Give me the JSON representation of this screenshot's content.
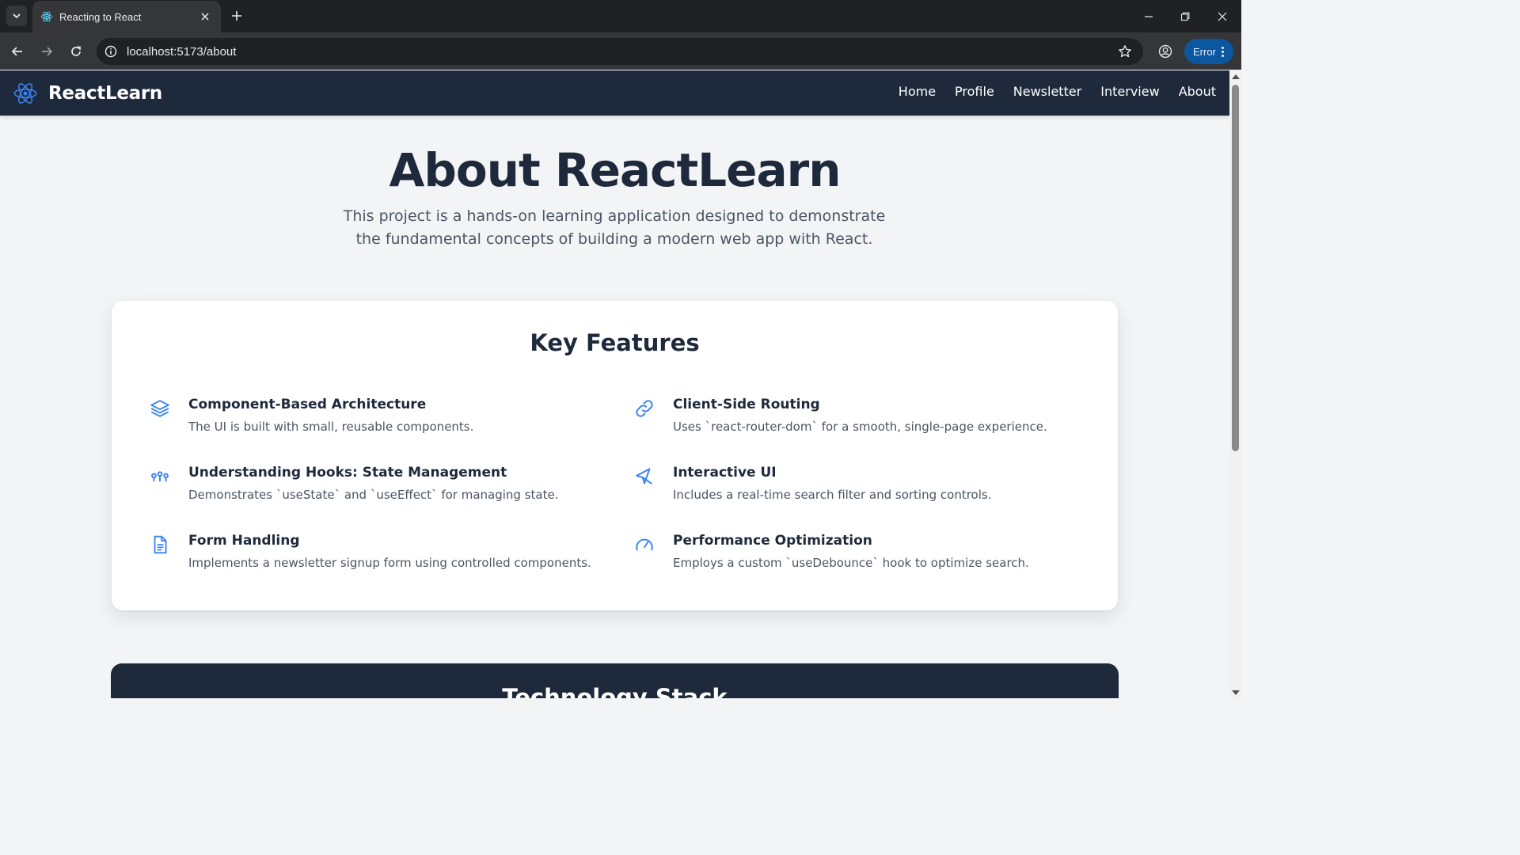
{
  "browser": {
    "tab_title": "Reacting to React",
    "url": "localhost:5173/about",
    "error_label": "Error"
  },
  "site": {
    "brand": "ReactLearn",
    "nav": [
      "Home",
      "Profile",
      "Newsletter",
      "Interview",
      "About"
    ]
  },
  "hero": {
    "title": "About ReactLearn",
    "subtitle": "This project is a hands-on learning application designed to demonstrate the fundamental concepts of building a modern web app with React."
  },
  "features_card": {
    "title": "Key Features",
    "items": [
      {
        "name": "Component-Based Architecture",
        "desc": "The UI is built with small, reusable components.",
        "icon": "layers-icon"
      },
      {
        "name": "Client-Side Routing",
        "desc": "Uses `react-router-dom` for a smooth, single-page experience.",
        "icon": "link-icon"
      },
      {
        "name": "Understanding Hooks: State Management",
        "desc": "Demonstrates `useState` and `useEffect` for managing state.",
        "icon": "hooks-icon"
      },
      {
        "name": "Interactive UI",
        "desc": "Includes a real-time search filter and sorting controls.",
        "icon": "pointer-icon"
      },
      {
        "name": "Form Handling",
        "desc": "Implements a newsletter signup form using controlled components.",
        "icon": "document-icon"
      },
      {
        "name": "Performance Optimization",
        "desc": "Employs a custom `useDebounce` hook to optimize search.",
        "icon": "gauge-icon"
      }
    ]
  },
  "tech_card": {
    "title": "Technology Stack"
  },
  "colors": {
    "nav_bg": "#1e293b",
    "accent": "#3b82f6",
    "page_bg": "#f3f4f6"
  }
}
